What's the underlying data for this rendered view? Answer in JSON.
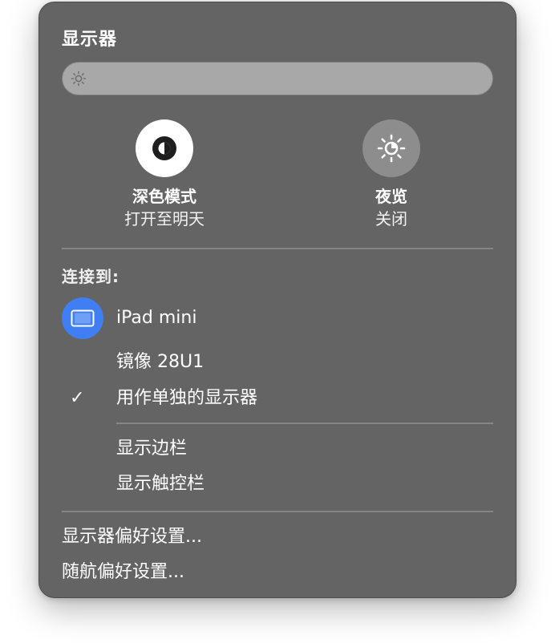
{
  "panel": {
    "title": "显示器"
  },
  "brightness": {
    "icon": "sun-small-icon",
    "level": 0
  },
  "toggles": [
    {
      "icon": "dark-mode-icon",
      "label": "深色模式",
      "status": "打开至明天",
      "active": true
    },
    {
      "icon": "night-shift-icon",
      "label": "夜览",
      "status": "关闭",
      "active": false
    }
  ],
  "connect": {
    "label": "连接到:",
    "device": {
      "icon": "ipad-icon",
      "name": "iPad mini"
    },
    "options": [
      {
        "label": "镜像 28U1",
        "checked": false
      },
      {
        "label": "用作单独的显示器",
        "checked": true
      }
    ],
    "check_glyph": "✓",
    "extras": [
      {
        "label": "显示边栏"
      },
      {
        "label": "显示触控栏"
      }
    ]
  },
  "footer": {
    "items": [
      {
        "label": "显示器偏好设置..."
      },
      {
        "label": "随航偏好设置..."
      }
    ]
  },
  "colors": {
    "panel_bg": "#636463",
    "accent_blue": "#3f7ff3",
    "slider_track": "#a7a8a7"
  }
}
